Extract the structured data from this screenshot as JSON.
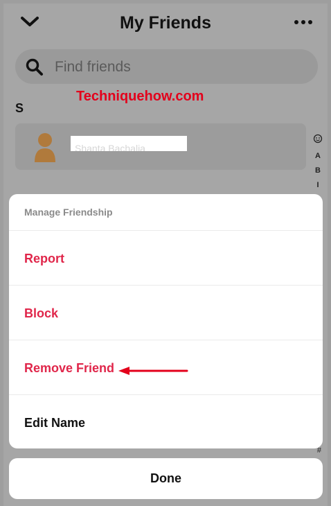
{
  "header": {
    "title": "My Friends"
  },
  "search": {
    "placeholder": "Find friends"
  },
  "watermark": "Techniquehow.com",
  "list": {
    "section_letter": "S",
    "friend_name": "Shanta Bachalia"
  },
  "index_bar": {
    "letters": [
      "A",
      "B",
      "I"
    ],
    "hash": "#"
  },
  "sheet": {
    "title": "Manage Friendship",
    "items": [
      {
        "label": "Report",
        "style": "danger"
      },
      {
        "label": "Block",
        "style": "danger"
      },
      {
        "label": "Remove Friend",
        "style": "danger"
      },
      {
        "label": "Edit Name",
        "style": "plain"
      }
    ]
  },
  "done_label": "Done",
  "colors": {
    "danger": "#e0264a",
    "watermark": "#e3001b",
    "arrow": "#e3001b",
    "dim_overlay": "#a6a6a6"
  }
}
